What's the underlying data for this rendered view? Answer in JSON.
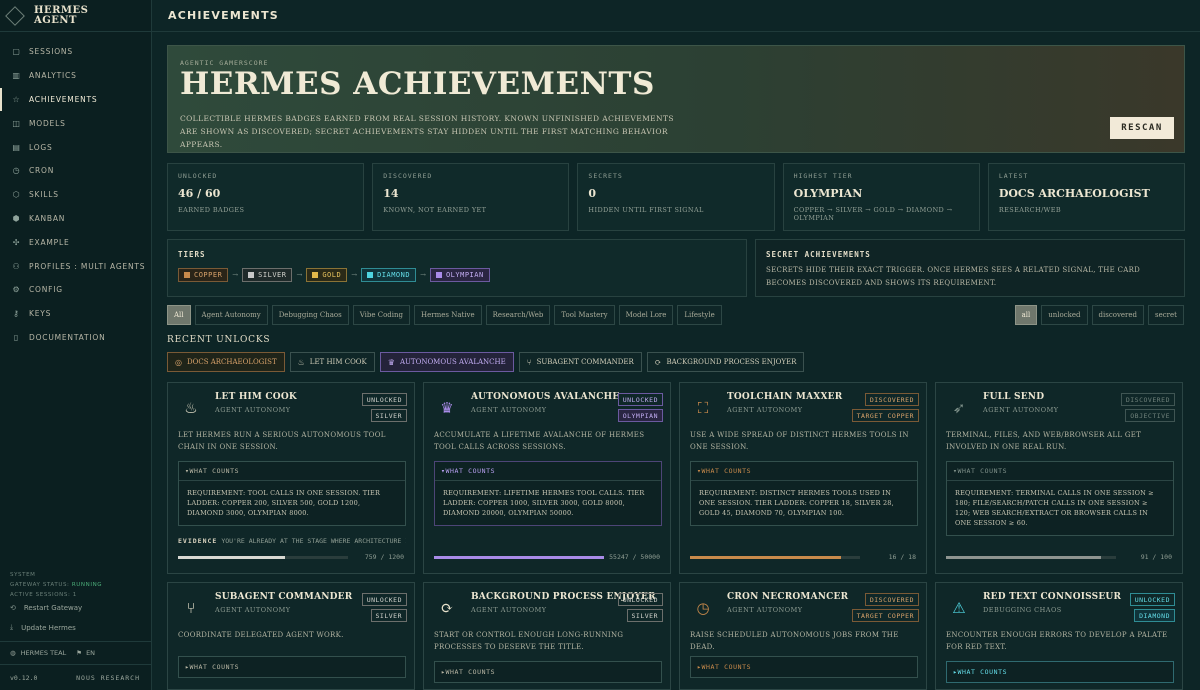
{
  "app": {
    "brand_line1": "HERMES",
    "brand_line2": "AGENT"
  },
  "sidebar": {
    "items": [
      {
        "label": "SESSIONS",
        "icon": "chat-icon"
      },
      {
        "label": "ANALYTICS",
        "icon": "chart-icon"
      },
      {
        "label": "ACHIEVEMENTS",
        "icon": "star-icon",
        "active": true
      },
      {
        "label": "MODELS",
        "icon": "cube-icon"
      },
      {
        "label": "LOGS",
        "icon": "file-icon"
      },
      {
        "label": "CRON",
        "icon": "clock-icon"
      },
      {
        "label": "SKILLS",
        "icon": "package-icon"
      },
      {
        "label": "KANBAN",
        "icon": "board-icon"
      },
      {
        "label": "EXAMPLE",
        "icon": "puzzle-icon"
      },
      {
        "label": "PROFILES : MULTI AGENTS",
        "icon": "users-icon"
      },
      {
        "label": "CONFIG",
        "icon": "gear-icon"
      },
      {
        "label": "KEYS",
        "icon": "key-icon"
      },
      {
        "label": "DOCUMENTATION",
        "icon": "book-icon"
      }
    ],
    "system_label": "SYSTEM",
    "gateway_label": "GATEWAY STATUS:",
    "gateway_value": "RUNNING",
    "active_sessions": "ACTIVE SESSIONS: 1",
    "restart": "Restart Gateway",
    "update": "Update Hermes",
    "theme": "HERMES TEAL",
    "lang": "EN",
    "version": "v0.12.0",
    "org": "NOUS RESEARCH"
  },
  "header": {
    "title": "ACHIEVEMENTS"
  },
  "hero": {
    "kicker": "AGENTIC GAMERSCORE",
    "title": "HERMES ACHIEVEMENTS",
    "desc": "COLLECTIBLE HERMES BADGES EARNED FROM REAL SESSION HISTORY. KNOWN UNFINISHED ACHIEVEMENTS ARE SHOWN AS DISCOVERED; SECRET ACHIEVEMENTS STAY HIDDEN UNTIL THE FIRST MATCHING BEHAVIOR APPEARS.",
    "rescan": "RESCAN"
  },
  "stats": [
    {
      "label": "UNLOCKED",
      "value": "46 / 60",
      "sub": "EARNED BADGES"
    },
    {
      "label": "DISCOVERED",
      "value": "14",
      "sub": "KNOWN, NOT EARNED YET"
    },
    {
      "label": "SECRETS",
      "value": "0",
      "sub": "HIDDEN UNTIL FIRST SIGNAL"
    },
    {
      "label": "HIGHEST TIER",
      "value": "OLYMPIAN",
      "sub": "COPPER → SILVER → GOLD → DIAMOND → OLYMPIAN"
    },
    {
      "label": "LATEST",
      "value": "DOCS ARCHAEOLOGIST",
      "sub": "RESEARCH/WEB"
    }
  ],
  "tiers": {
    "label": "TIERS",
    "items": [
      {
        "name": "COPPER",
        "color": "#c98a4b"
      },
      {
        "name": "SILVER",
        "color": "#c8c8c8"
      },
      {
        "name": "GOLD",
        "color": "#e3b84a"
      },
      {
        "name": "DIAMOND",
        "color": "#4fd4e0"
      },
      {
        "name": "OLYMPIAN",
        "color": "#a98be8"
      }
    ]
  },
  "secret": {
    "label": "SECRET ACHIEVEMENTS",
    "text": "SECRETS HIDE THEIR EXACT TRIGGER. ONCE HERMES SEES A RELATED SIGNAL, THE CARD BECOMES DISCOVERED AND SHOWS ITS REQUIREMENT."
  },
  "filters": {
    "categories": [
      "All",
      "Agent Autonomy",
      "Debugging Chaos",
      "Vibe Coding",
      "Hermes Native",
      "Research/Web",
      "Tool Mastery",
      "Model Lore",
      "Lifestyle"
    ],
    "states": [
      "all",
      "unlocked",
      "discovered",
      "secret"
    ]
  },
  "recent": {
    "title": "RECENT UNLOCKS",
    "items": [
      {
        "label": "DOCS ARCHAEOLOGIST",
        "icon": "compass-icon"
      },
      {
        "label": "LET HIM COOK",
        "icon": "flame-icon"
      },
      {
        "label": "AUTONOMOUS AVALANCHE",
        "icon": "crown-icon"
      },
      {
        "label": "SUBAGENT COMMANDER",
        "icon": "branch-icon"
      },
      {
        "label": "BACKGROUND PROCESS ENJOYER",
        "icon": "refresh-icon"
      }
    ]
  },
  "what_counts": "WHAT COUNTS",
  "evidence_label": "EVIDENCE",
  "cards": [
    {
      "title": "LET HIM COOK",
      "category": "AGENT AUTONOMY",
      "status": "UNLOCKED",
      "tier": "SILVER",
      "desc": "LET HERMES RUN A SERIOUS AUTONOMOUS TOOL CHAIN IN ONE SESSION.",
      "requirement": "REQUIREMENT: TOOL CALLS IN ONE SESSION. TIER LADDER: COPPER 200, SILVER 500, GOLD 1200, DIAMOND 3000, OLYMPIAN 8000.",
      "evidence": "YOU'RE ALREADY AT THE STAGE WHERE ARCHITECTURE IS...",
      "progress_text": "759 / 1200",
      "progress": 0.63
    },
    {
      "title": "AUTONOMOUS AVALANCHE",
      "category": "AGENT AUTONOMY",
      "status": "UNLOCKED",
      "tier": "OLYMPIAN",
      "desc": "ACCUMULATE A LIFETIME AVALANCHE OF HERMES TOOL CALLS ACROSS SESSIONS.",
      "requirement": "REQUIREMENT: LIFETIME HERMES TOOL CALLS. TIER LADDER: COPPER 1000, SILVER 3000, GOLD 8000, DIAMOND 20000, OLYMPIAN 50000.",
      "progress_text": "55247 / 50000",
      "progress": 1.0
    },
    {
      "title": "TOOLCHAIN MAXXER",
      "category": "AGENT AUTONOMY",
      "status": "DISCOVERED",
      "tier": "TARGET COPPER",
      "desc": "USE A WIDE SPREAD OF DISTINCT HERMES TOOLS IN ONE SESSION.",
      "requirement": "REQUIREMENT: DISTINCT HERMES TOOLS USED IN ONE SESSION. TIER LADDER: COPPER 18, SILVER 28, GOLD 45, DIAMOND 70, OLYMPIAN 100.",
      "progress_text": "16 / 18",
      "progress": 0.89
    },
    {
      "title": "FULL SEND",
      "category": "AGENT AUTONOMY",
      "status": "DISCOVERED",
      "tier": "OBJECTIVE",
      "desc": "TERMINAL, FILES, AND WEB/BROWSER ALL GET INVOLVED IN ONE REAL RUN.",
      "requirement": "REQUIREMENT: TERMINAL CALLS IN ONE SESSION ≥ 180; FILE/SEARCH/PATCH CALLS IN ONE SESSION ≥ 120; WEB SEARCH/EXTRACT OR BROWSER CALLS IN ONE SESSION ≥ 60.",
      "progress_text": "91 / 100",
      "progress": 0.91
    },
    {
      "title": "SUBAGENT COMMANDER",
      "category": "AGENT AUTONOMY",
      "status": "UNLOCKED",
      "tier": "SILVER",
      "desc": "COORDINATE DELEGATED AGENT WORK."
    },
    {
      "title": "BACKGROUND PROCESS ENJOYER",
      "category": "AGENT AUTONOMY",
      "status": "UNLOCKED",
      "tier": "SILVER",
      "desc": "START OR CONTROL ENOUGH LONG-RUNNING PROCESSES TO DESERVE THE TITLE."
    },
    {
      "title": "CRON NECROMANCER",
      "category": "AGENT AUTONOMY",
      "status": "DISCOVERED",
      "tier": "TARGET COPPER",
      "desc": "RAISE SCHEDULED AUTONOMOUS JOBS FROM THE DEAD."
    },
    {
      "title": "RED TEXT CONNOISSEUR",
      "category": "DEBUGGING CHAOS",
      "status": "UNLOCKED",
      "tier": "DIAMOND",
      "desc": "ENCOUNTER ENOUGH ERRORS TO DEVELOP A PALATE FOR RED TEXT."
    }
  ]
}
